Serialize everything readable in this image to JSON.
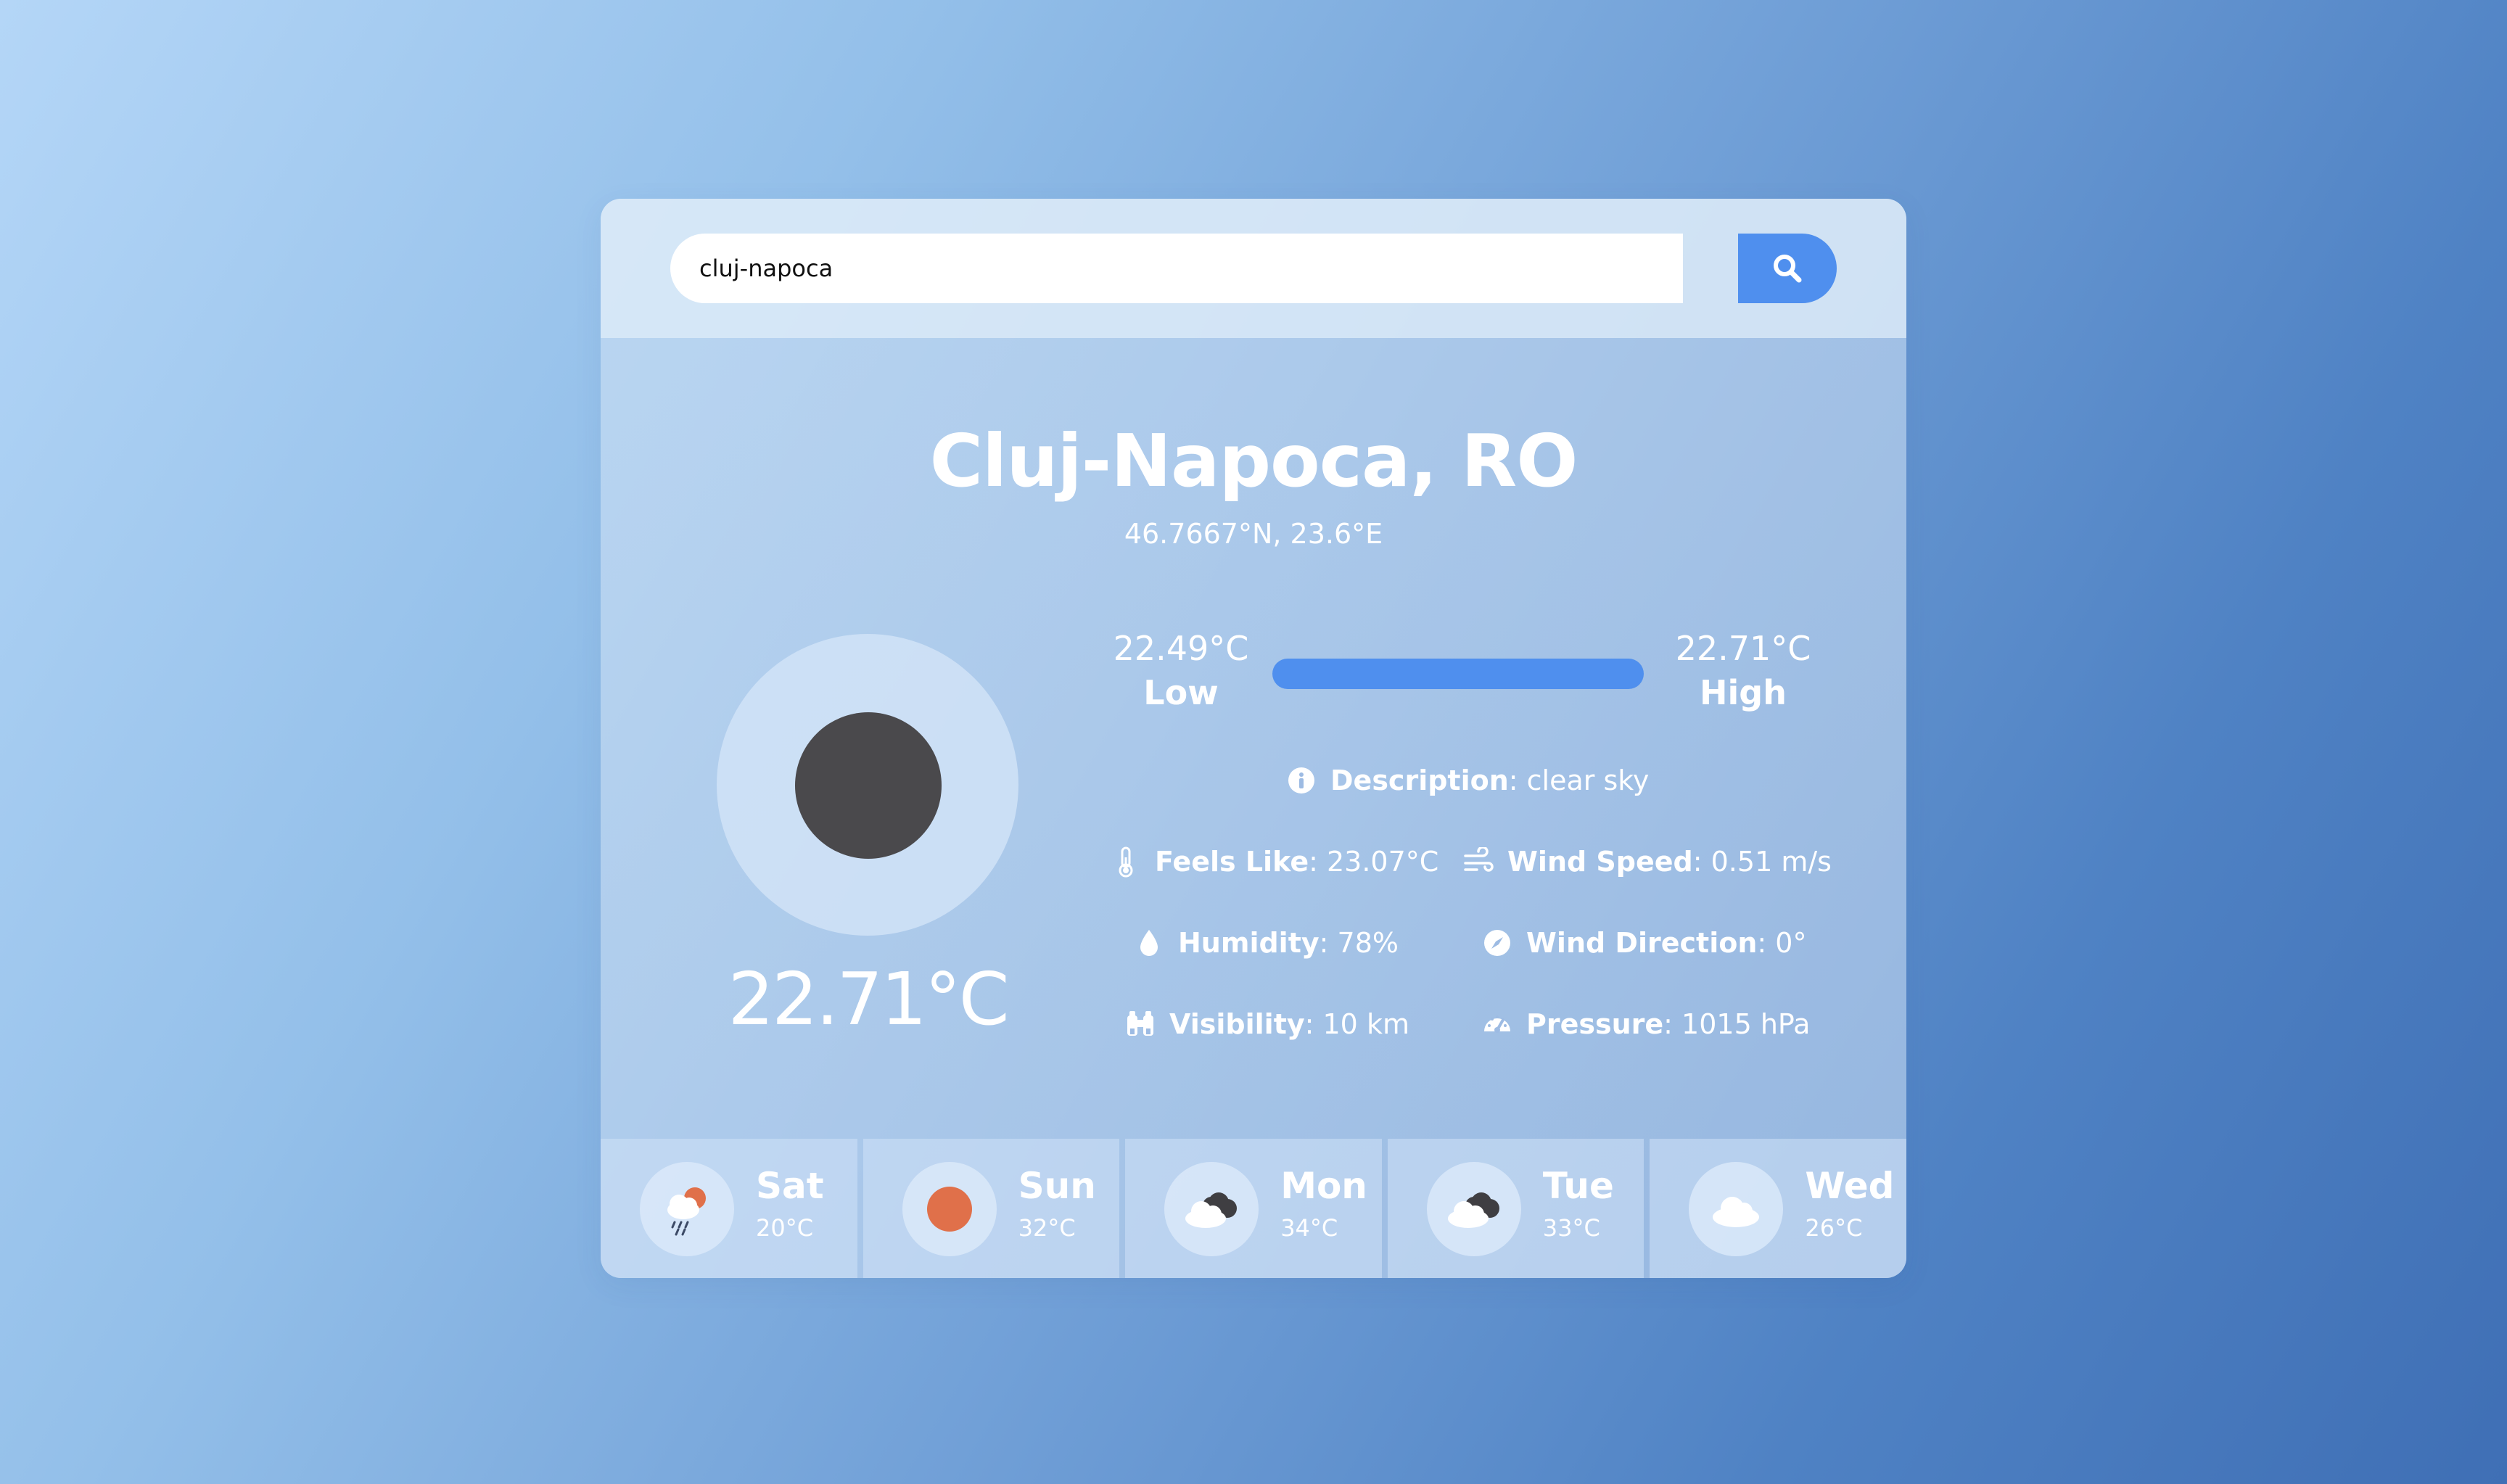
{
  "search": {
    "value": "cluj-napoca",
    "button_icon": "search-icon"
  },
  "location": {
    "name": "Cluj-Napoca, RO",
    "coordinates": "46.7667°N, 23.6°E"
  },
  "current": {
    "temperature": "22.71°C",
    "icon": "clear-sky-icon",
    "low": {
      "value": "22.49°C",
      "label": "Low"
    },
    "high": {
      "value": "22.71°C",
      "label": "High"
    }
  },
  "details": {
    "description": {
      "label": "Description",
      "value": ": clear sky",
      "icon": "info-icon"
    },
    "feels_like": {
      "label": "Feels Like",
      "value": ": 23.07°C",
      "icon": "thermometer-icon"
    },
    "wind_speed": {
      "label": "Wind Speed",
      "value": ": 0.51 m/s",
      "icon": "wind-icon"
    },
    "humidity": {
      "label": "Humidity",
      "value": ": 78%",
      "icon": "droplet-icon"
    },
    "wind_direction": {
      "label": "Wind Direction",
      "value": ": 0°",
      "icon": "compass-icon"
    },
    "visibility": {
      "label": "Visibility",
      "value": ": 10 km",
      "icon": "binoculars-icon"
    },
    "pressure": {
      "label": "Pressure",
      "value": ": 1015 hPa",
      "icon": "gauge-icon"
    }
  },
  "forecast": [
    {
      "day": "Sat",
      "temp": "20°C",
      "icon": "rain-sun-cloud-icon"
    },
    {
      "day": "Sun",
      "temp": "32°C",
      "icon": "sun-icon"
    },
    {
      "day": "Mon",
      "temp": "34°C",
      "icon": "broken-clouds-icon"
    },
    {
      "day": "Tue",
      "temp": "33°C",
      "icon": "broken-clouds-icon"
    },
    {
      "day": "Wed",
      "temp": "26°C",
      "icon": "cloud-icon"
    }
  ],
  "colors": {
    "accent": "#4f8fee",
    "sun": "#e0704a",
    "dark_cloud": "#4a494c"
  }
}
